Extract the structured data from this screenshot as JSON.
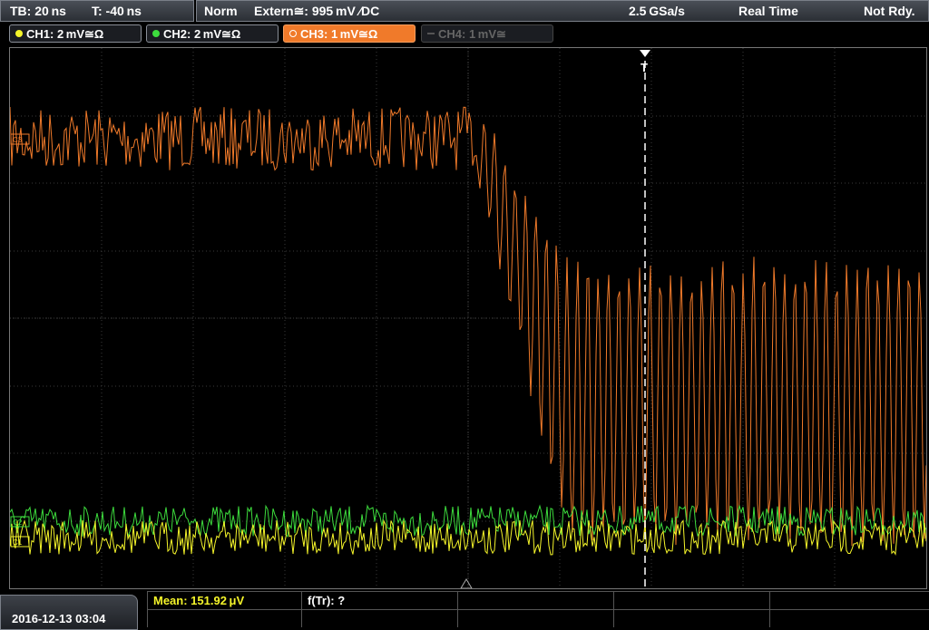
{
  "status": {
    "timebase": "TB: 20 ns",
    "trigger_time": "T: -40 ns",
    "mode": "Norm",
    "trigger_source": "Extern≅: 995 mV ∕DC",
    "sample_rate": "2.5 GSa/s",
    "acq_mode": "Real Time",
    "state": "Not Rdy."
  },
  "channels": [
    {
      "label": "CH1: 2 mV≅Ω",
      "color": "#f5f52a",
      "state": "on"
    },
    {
      "label": "CH2: 2 mV≅Ω",
      "color": "#3ddc3d",
      "state": "on"
    },
    {
      "label": "CH3: 1 mV≅Ω",
      "color": "#f07a2a",
      "state": "active"
    },
    {
      "label": "CH4: 1 mV≅",
      "color": "#666666",
      "state": "off"
    }
  ],
  "measurements": {
    "mean": "Mean: 151.92 μV",
    "ftr": "f(Tr): ?"
  },
  "datetime": "2016-12-13 03:04",
  "markers": {
    "trigger_marker": "T",
    "ch3_marker": "C3",
    "ch2_marker": "C2",
    "ch1_marker": "C1"
  },
  "colors": {
    "ch1": "#f5f52a",
    "ch2": "#3ddc3d",
    "ch3": "#f07a2a",
    "grid": "#3a3a3a"
  }
}
